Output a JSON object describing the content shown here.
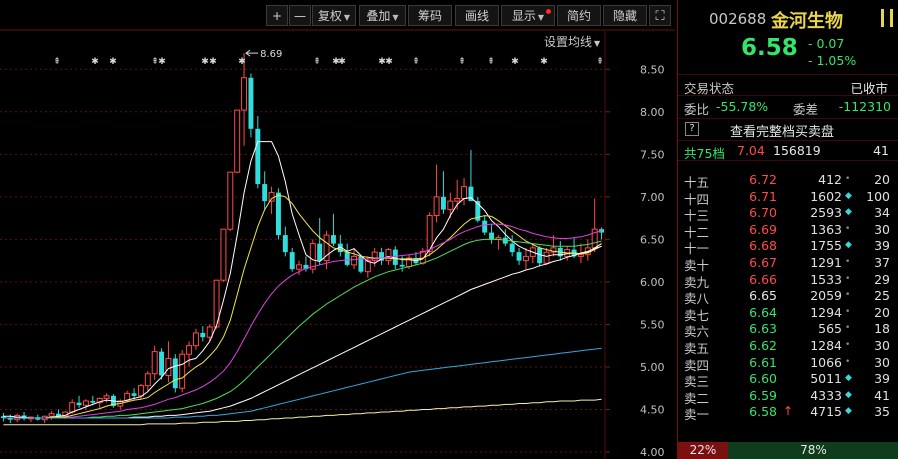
{
  "toolbar": {
    "plus_label": "+",
    "minus_label": "—",
    "fuquan_label": "复权",
    "diejia_label": "叠加",
    "choumia_label": "筹码",
    "huaxian_label": "画线",
    "xianshi_label": "显示",
    "jianyue_label": "简约",
    "yincang_label": "隐藏"
  },
  "chart_header": {
    "set_ma_label": "设置均线"
  },
  "max_marker_label": "8.69",
  "chart_data": {
    "type": "candlestick",
    "ylim": [
      4.0,
      8.75
    ],
    "y_ticks": [
      "8.50",
      "8.00",
      "7.50",
      "7.00",
      "6.50",
      "6.00",
      "5.50",
      "5.00",
      "4.50",
      "4.00"
    ],
    "y_tick_values": [
      8.5,
      8.0,
      7.5,
      7.0,
      6.5,
      6.0,
      5.5,
      5.0,
      4.5,
      4.0
    ],
    "max_annotation": 8.69,
    "ohlc": [
      [
        4.42,
        4.46,
        4.36,
        4.4
      ],
      [
        4.4,
        4.44,
        4.34,
        4.38
      ],
      [
        4.38,
        4.45,
        4.35,
        4.43
      ],
      [
        4.43,
        4.47,
        4.37,
        4.39
      ],
      [
        4.39,
        4.42,
        4.35,
        4.41
      ],
      [
        4.41,
        4.44,
        4.37,
        4.38
      ],
      [
        4.38,
        4.43,
        4.34,
        4.42
      ],
      [
        4.42,
        4.48,
        4.38,
        4.45
      ],
      [
        4.45,
        4.5,
        4.4,
        4.42
      ],
      [
        4.42,
        4.48,
        4.39,
        4.47
      ],
      [
        4.47,
        4.62,
        4.45,
        4.58
      ],
      [
        4.58,
        4.66,
        4.52,
        4.55
      ],
      [
        4.55,
        4.62,
        4.5,
        4.6
      ],
      [
        4.6,
        4.66,
        4.55,
        4.58
      ],
      [
        4.58,
        4.64,
        4.52,
        4.63
      ],
      [
        4.63,
        4.69,
        4.58,
        4.66
      ],
      [
        4.66,
        4.68,
        4.52,
        4.54
      ],
      [
        4.54,
        4.62,
        4.5,
        4.6
      ],
      [
        4.6,
        4.72,
        4.58,
        4.69
      ],
      [
        4.69,
        4.75,
        4.62,
        4.66
      ],
      [
        4.66,
        4.8,
        4.62,
        4.78
      ],
      [
        4.78,
        4.95,
        4.72,
        4.92
      ],
      [
        4.92,
        5.25,
        4.85,
        5.18
      ],
      [
        5.18,
        5.22,
        4.85,
        4.9
      ],
      [
        4.9,
        5.3,
        4.82,
        5.1
      ],
      [
        5.1,
        5.15,
        4.7,
        4.75
      ],
      [
        4.75,
        5.2,
        4.7,
        5.15
      ],
      [
        5.15,
        5.3,
        5.0,
        5.25
      ],
      [
        5.25,
        5.45,
        5.2,
        5.4
      ],
      [
        5.4,
        5.48,
        5.3,
        5.35
      ],
      [
        5.35,
        5.5,
        5.3,
        5.47
      ],
      [
        5.47,
        6.02,
        5.45,
        6.02
      ],
      [
        6.02,
        6.62,
        6.0,
        6.62
      ],
      [
        6.62,
        7.29,
        6.6,
        7.29
      ],
      [
        7.29,
        8.02,
        7.28,
        8.02
      ],
      [
        8.02,
        8.69,
        7.6,
        8.4
      ],
      [
        8.4,
        8.45,
        7.7,
        7.8
      ],
      [
        7.8,
        7.95,
        7.1,
        7.15
      ],
      [
        7.15,
        7.3,
        6.85,
        6.95
      ],
      [
        6.95,
        7.12,
        6.8,
        7.05
      ],
      [
        7.05,
        7.1,
        6.5,
        6.55
      ],
      [
        6.55,
        6.65,
        6.3,
        6.35
      ],
      [
        6.35,
        6.4,
        6.12,
        6.15
      ],
      [
        6.15,
        6.25,
        6.08,
        6.2
      ],
      [
        6.2,
        6.3,
        6.12,
        6.15
      ],
      [
        6.15,
        6.5,
        6.1,
        6.45
      ],
      [
        6.45,
        6.75,
        6.2,
        6.25
      ],
      [
        6.25,
        6.6,
        6.15,
        6.55
      ],
      [
        6.55,
        6.8,
        6.42,
        6.45
      ],
      [
        6.45,
        6.55,
        6.3,
        6.35
      ],
      [
        6.35,
        6.45,
        6.18,
        6.2
      ],
      [
        6.2,
        6.4,
        6.15,
        6.3
      ],
      [
        6.3,
        6.32,
        6.1,
        6.12
      ],
      [
        6.12,
        6.3,
        6.05,
        6.25
      ],
      [
        6.25,
        6.4,
        6.18,
        6.35
      ],
      [
        6.35,
        6.4,
        6.2,
        6.25
      ],
      [
        6.25,
        6.4,
        6.2,
        6.38
      ],
      [
        6.38,
        6.42,
        6.15,
        6.2
      ],
      [
        6.2,
        6.3,
        6.12,
        6.18
      ],
      [
        6.18,
        6.32,
        6.15,
        6.28
      ],
      [
        6.28,
        6.35,
        6.2,
        6.22
      ],
      [
        6.22,
        6.4,
        6.2,
        6.36
      ],
      [
        6.36,
        6.82,
        6.3,
        6.78
      ],
      [
        6.78,
        7.38,
        6.7,
        7.0
      ],
      [
        7.0,
        7.3,
        6.8,
        6.85
      ],
      [
        6.85,
        7.05,
        6.75,
        6.95
      ],
      [
        6.95,
        7.2,
        6.85,
        6.98
      ],
      [
        6.98,
        7.22,
        6.9,
        7.12
      ],
      [
        7.12,
        7.55,
        6.95,
        6.95
      ],
      [
        6.95,
        7.0,
        6.7,
        6.72
      ],
      [
        6.72,
        6.78,
        6.55,
        6.58
      ],
      [
        6.58,
        6.68,
        6.45,
        6.5
      ],
      [
        6.5,
        6.55,
        6.38,
        6.52
      ],
      [
        6.52,
        6.62,
        6.42,
        6.45
      ],
      [
        6.45,
        6.55,
        6.3,
        6.35
      ],
      [
        6.35,
        6.4,
        6.2,
        6.25
      ],
      [
        6.25,
        6.4,
        6.15,
        6.3
      ],
      [
        6.3,
        6.45,
        6.22,
        6.4
      ],
      [
        6.4,
        6.42,
        6.18,
        6.22
      ],
      [
        6.22,
        6.4,
        6.2,
        6.35
      ],
      [
        6.35,
        6.55,
        6.3,
        6.4
      ],
      [
        6.4,
        6.48,
        6.25,
        6.3
      ],
      [
        6.3,
        6.42,
        6.25,
        6.38
      ],
      [
        6.38,
        6.52,
        6.28,
        6.3
      ],
      [
        6.3,
        6.45,
        6.22,
        6.32
      ],
      [
        6.32,
        6.5,
        6.25,
        6.4
      ],
      [
        6.4,
        6.98,
        6.35,
        6.62
      ],
      [
        6.62,
        6.64,
        6.5,
        6.58
      ]
    ],
    "ma_lines": [
      {
        "color": "#ffffff",
        "values": [
          4.42,
          4.42,
          4.41,
          4.41,
          4.4,
          4.4,
          4.4,
          4.41,
          4.42,
          4.43,
          4.47,
          4.5,
          4.53,
          4.56,
          4.59,
          4.61,
          4.6,
          4.59,
          4.61,
          4.63,
          4.65,
          4.71,
          4.8,
          4.88,
          4.98,
          5.01,
          5.03,
          5.08,
          5.1,
          5.19,
          5.3,
          5.49,
          5.78,
          6.1,
          6.55,
          7.05,
          7.42,
          7.65,
          7.65,
          7.65,
          7.48,
          7.18,
          6.8,
          6.55,
          6.32,
          6.26,
          6.24,
          6.31,
          6.37,
          6.41,
          6.36,
          6.39,
          6.31,
          6.24,
          6.22,
          6.27,
          6.3,
          6.28,
          6.26,
          6.26,
          6.25,
          6.27,
          6.38,
          6.52,
          6.62,
          6.78,
          6.91,
          6.98,
          6.99,
          6.92,
          6.84,
          6.72,
          6.65,
          6.56,
          6.48,
          6.42,
          6.38,
          6.35,
          6.32,
          6.3,
          6.32,
          6.32,
          6.33,
          6.34,
          6.33,
          6.35,
          6.4,
          6.45
        ]
      },
      {
        "color": "#f2e64a",
        "values": [
          4.4,
          4.4,
          4.4,
          4.4,
          4.4,
          4.4,
          4.4,
          4.41,
          4.41,
          4.41,
          4.43,
          4.45,
          4.47,
          4.49,
          4.51,
          4.54,
          4.56,
          4.57,
          4.59,
          4.61,
          4.62,
          4.64,
          4.7,
          4.75,
          4.8,
          4.85,
          4.87,
          4.94,
          5.0,
          5.05,
          5.13,
          5.22,
          5.35,
          5.55,
          5.85,
          6.15,
          6.4,
          6.65,
          6.85,
          6.98,
          7.02,
          7.0,
          6.92,
          6.8,
          6.7,
          6.6,
          6.52,
          6.46,
          6.4,
          6.38,
          6.35,
          6.33,
          6.3,
          6.29,
          6.28,
          6.28,
          6.28,
          6.27,
          6.27,
          6.27,
          6.27,
          6.28,
          6.32,
          6.38,
          6.45,
          6.52,
          6.6,
          6.68,
          6.74,
          6.76,
          6.78,
          6.77,
          6.72,
          6.66,
          6.6,
          6.54,
          6.48,
          6.44,
          6.4,
          6.38,
          6.36,
          6.35,
          6.34,
          6.34,
          6.33,
          6.34,
          6.38,
          6.42
        ]
      },
      {
        "color": "#e040e0",
        "values": [
          4.4,
          4.4,
          4.4,
          4.4,
          4.4,
          4.4,
          4.4,
          4.4,
          4.4,
          4.4,
          4.41,
          4.42,
          4.43,
          4.44,
          4.45,
          4.46,
          4.47,
          4.48,
          4.5,
          4.51,
          4.52,
          4.54,
          4.56,
          4.59,
          4.62,
          4.64,
          4.67,
          4.7,
          4.73,
          4.77,
          4.82,
          4.88,
          4.95,
          5.05,
          5.18,
          5.33,
          5.48,
          5.62,
          5.75,
          5.86,
          5.95,
          6.02,
          6.08,
          6.12,
          6.16,
          6.18,
          6.2,
          6.22,
          6.24,
          6.25,
          6.26,
          6.26,
          6.27,
          6.27,
          6.27,
          6.28,
          6.29,
          6.3,
          6.31,
          6.32,
          6.33,
          6.35,
          6.38,
          6.42,
          6.46,
          6.5,
          6.55,
          6.59,
          6.62,
          6.65,
          6.67,
          6.68,
          6.68,
          6.67,
          6.65,
          6.62,
          6.6,
          6.57,
          6.55,
          6.53,
          6.52,
          6.51,
          6.51,
          6.52,
          6.53,
          6.55,
          6.58,
          6.6
        ]
      },
      {
        "color": "#4ce05a",
        "values": [
          4.4,
          4.4,
          4.4,
          4.4,
          4.4,
          4.4,
          4.4,
          4.4,
          4.4,
          4.4,
          4.4,
          4.4,
          4.4,
          4.41,
          4.41,
          4.42,
          4.42,
          4.43,
          4.43,
          4.44,
          4.45,
          4.46,
          4.47,
          4.48,
          4.49,
          4.5,
          4.51,
          4.53,
          4.55,
          4.57,
          4.6,
          4.63,
          4.67,
          4.71,
          4.77,
          4.84,
          4.92,
          5.0,
          5.08,
          5.16,
          5.24,
          5.32,
          5.4,
          5.48,
          5.55,
          5.62,
          5.68,
          5.74,
          5.79,
          5.84,
          5.89,
          5.94,
          5.98,
          6.02,
          6.06,
          6.09,
          6.12,
          6.14,
          6.16,
          6.18,
          6.2,
          6.22,
          6.25,
          6.28,
          6.32,
          6.36,
          6.4,
          6.44,
          6.47,
          6.49,
          6.5,
          6.5,
          6.5,
          6.49,
          6.48,
          6.47,
          6.46,
          6.45,
          6.44,
          6.43,
          6.42,
          6.42,
          6.42,
          6.42,
          6.43,
          6.44,
          6.46,
          6.48
        ]
      },
      {
        "color": "#ffffff",
        "values": [
          4.4,
          4.4,
          4.4,
          4.4,
          4.4,
          4.4,
          4.4,
          4.4,
          4.4,
          4.4,
          4.4,
          4.4,
          4.4,
          4.4,
          4.4,
          4.4,
          4.4,
          4.4,
          4.4,
          4.41,
          4.41,
          4.41,
          4.42,
          4.42,
          4.43,
          4.43,
          4.44,
          4.45,
          4.46,
          4.47,
          4.48,
          4.5,
          4.52,
          4.54,
          4.57,
          4.6,
          4.63,
          4.67,
          4.71,
          4.75,
          4.79,
          4.83,
          4.87,
          4.91,
          4.95,
          4.99,
          5.03,
          5.07,
          5.11,
          5.15,
          5.19,
          5.23,
          5.27,
          5.31,
          5.35,
          5.39,
          5.43,
          5.47,
          5.51,
          5.55,
          5.59,
          5.63,
          5.67,
          5.71,
          5.75,
          5.79,
          5.83,
          5.87,
          5.91,
          5.94,
          5.97,
          6.0,
          6.03,
          6.06,
          6.09,
          6.11,
          6.14,
          6.16,
          6.19,
          6.21,
          6.24,
          6.26,
          6.29,
          6.31,
          6.34,
          6.36,
          6.39,
          6.42
        ]
      },
      {
        "color": "#34a8e0",
        "values": [
          4.4,
          4.4,
          4.4,
          4.4,
          4.4,
          4.4,
          4.4,
          4.4,
          4.4,
          4.4,
          4.4,
          4.4,
          4.4,
          4.4,
          4.4,
          4.4,
          4.4,
          4.4,
          4.4,
          4.4,
          4.4,
          4.4,
          4.4,
          4.4,
          4.4,
          4.41,
          4.41,
          4.41,
          4.42,
          4.42,
          4.43,
          4.43,
          4.44,
          4.45,
          4.46,
          4.47,
          4.48,
          4.5,
          4.52,
          4.54,
          4.56,
          4.58,
          4.6,
          4.62,
          4.64,
          4.66,
          4.68,
          4.7,
          4.72,
          4.74,
          4.76,
          4.78,
          4.8,
          4.82,
          4.84,
          4.86,
          4.88,
          4.9,
          4.92,
          4.94,
          4.95,
          4.96,
          4.97,
          4.98,
          4.99,
          5.0,
          5.01,
          5.02,
          5.03,
          5.04,
          5.05,
          5.06,
          5.07,
          5.08,
          5.09,
          5.1,
          5.11,
          5.12,
          5.13,
          5.14,
          5.15,
          5.16,
          5.17,
          5.18,
          5.19,
          5.2,
          5.21,
          5.22
        ]
      },
      {
        "color": "#f4f0a8",
        "values": [
          4.32,
          4.32,
          4.32,
          4.32,
          4.32,
          4.32,
          4.32,
          4.32,
          4.32,
          4.32,
          4.32,
          4.32,
          4.32,
          4.32,
          4.32,
          4.32,
          4.32,
          4.32,
          4.32,
          4.32,
          4.32,
          4.33,
          4.33,
          4.33,
          4.33,
          4.33,
          4.34,
          4.34,
          4.34,
          4.35,
          4.35,
          4.35,
          4.36,
          4.36,
          4.36,
          4.37,
          4.37,
          4.38,
          4.38,
          4.39,
          4.39,
          4.4,
          4.4,
          4.41,
          4.41,
          4.42,
          4.42,
          4.43,
          4.43,
          4.44,
          4.44,
          4.45,
          4.45,
          4.46,
          4.46,
          4.47,
          4.47,
          4.48,
          4.48,
          4.49,
          4.49,
          4.5,
          4.5,
          4.51,
          4.51,
          4.52,
          4.52,
          4.53,
          4.53,
          4.54,
          4.54,
          4.55,
          4.55,
          4.56,
          4.56,
          4.57,
          4.57,
          4.58,
          4.58,
          4.59,
          4.59,
          4.6,
          4.6,
          4.6,
          4.61,
          4.61,
          4.61,
          4.62
        ]
      }
    ]
  },
  "stock": {
    "code": "002688",
    "name": "金河生物",
    "price": "6.58",
    "change": "- 0.07",
    "change_pct": "- 1.05%"
  },
  "status": {
    "trade_status_label": "交易状态",
    "trade_status_value": "已收市",
    "weibi_label": "委比",
    "weibi_value": "-55.78%",
    "weicha_label": "委差",
    "weicha_value": "-112310",
    "help_icon_text": "?",
    "full_book_label": "查看完整档买卖盘",
    "total_label": "共75档",
    "total_price": "7.04",
    "total_volume": "156819",
    "total_count": "41"
  },
  "sell_orders": [
    {
      "label": "十五",
      "price": "6.72",
      "volume": "412",
      "marker": "dot",
      "count": "20"
    },
    {
      "label": "十四",
      "price": "6.71",
      "volume": "1602",
      "marker": "diamond",
      "count": "100"
    },
    {
      "label": "十三",
      "price": "6.70",
      "volume": "2593",
      "marker": "diamond",
      "count": "34"
    },
    {
      "label": "十二",
      "price": "6.69",
      "volume": "1363",
      "marker": "dot",
      "count": "30"
    },
    {
      "label": "十一",
      "price": "6.68",
      "volume": "1755",
      "marker": "diamond",
      "count": "39"
    },
    {
      "label": "卖十",
      "price": "6.67",
      "volume": "1291",
      "marker": "dot",
      "count": "37"
    },
    {
      "label": "卖九",
      "price": "6.66",
      "volume": "1533",
      "marker": "dot",
      "count": "29"
    },
    {
      "label": "卖八",
      "price": "6.65",
      "volume": "2059",
      "marker": "dot",
      "count": "25"
    },
    {
      "label": "卖七",
      "price": "6.64",
      "volume": "1294",
      "marker": "dot",
      "count": "20"
    },
    {
      "label": "卖六",
      "price": "6.63",
      "volume": "565",
      "marker": "dot",
      "count": "18"
    },
    {
      "label": "卖五",
      "price": "6.62",
      "volume": "1284",
      "marker": "dot",
      "count": "30"
    },
    {
      "label": "卖四",
      "price": "6.61",
      "volume": "1066",
      "marker": "dot",
      "count": "30"
    },
    {
      "label": "卖三",
      "price": "6.60",
      "volume": "5011",
      "marker": "diamond",
      "count": "39"
    },
    {
      "label": "卖二",
      "price": "6.59",
      "volume": "4333",
      "marker": "diamond",
      "count": "41"
    },
    {
      "label": "卖一",
      "price": "6.58",
      "volume": "4715",
      "marker": "diamond",
      "count": "35",
      "arrow": "↑"
    }
  ],
  "footer": {
    "left_pct": "22%",
    "right_pct": "78%"
  },
  "colors": {
    "up": "#ff4a4a",
    "down": "#31dcdc",
    "accent": "#e8d44d",
    "green": "#35e46b"
  }
}
